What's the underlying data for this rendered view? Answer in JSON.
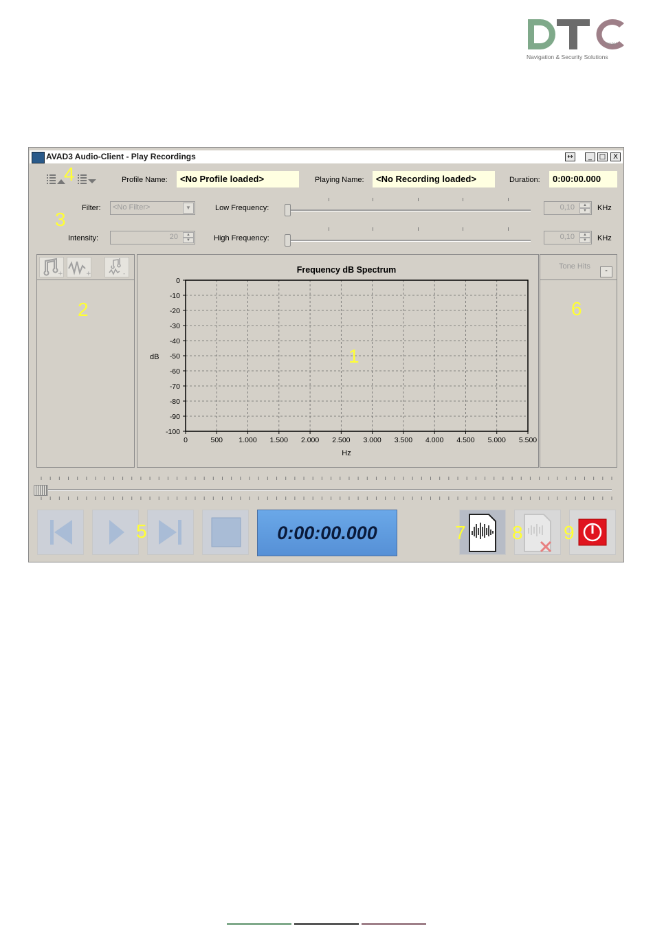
{
  "logo": {
    "text": "DTC",
    "gmbh": "GmbH",
    "tagline": "Navigation & Security Solutions",
    "colors": {
      "green": "#7fa98a",
      "gray": "#6b6b6b",
      "mauve": "#9e7f88"
    }
  },
  "window": {
    "title": "AVAD3 Audio-Client - Play Recordings",
    "buttons": {
      "resize": "↔",
      "minimize": "_",
      "maximize": "□",
      "close": "X"
    }
  },
  "header": {
    "profile_label": "Profile Name:",
    "profile_value": "<No Profile loaded>",
    "playing_label": "Playing Name:",
    "playing_value": "<No Recording loaded>",
    "duration_label": "Duration:",
    "duration_value": "0:00:00.000"
  },
  "filters": {
    "filter_label": "Filter:",
    "filter_value": "<No Filter>",
    "intensity_label": "Intensity:",
    "intensity_value": "20",
    "low_freq_label": "Low Frequency:",
    "low_freq_value": "0,10",
    "high_freq_label": "High Frequency:",
    "high_freq_value": "0,10",
    "unit": "KHz"
  },
  "tone_hits": {
    "label": "Tone Hits",
    "button": "-"
  },
  "transport": {
    "time": "0:00:00.000"
  },
  "annotations": [
    "1",
    "2",
    "3",
    "4",
    "5",
    "6",
    "7",
    "8",
    "9"
  ],
  "chart_data": {
    "type": "line",
    "title": "Frequency dB Spectrum",
    "xlabel": "Hz",
    "ylabel": "dB",
    "x_ticks": [
      "0",
      "500",
      "1.000",
      "1.500",
      "2.000",
      "2.500",
      "3.000",
      "3.500",
      "4.000",
      "4.500",
      "5.000",
      "5.500"
    ],
    "y_ticks": [
      "0",
      "-10",
      "-20",
      "-30",
      "-40",
      "-50",
      "-60",
      "-70",
      "-80",
      "-90",
      "-100"
    ],
    "xlim": [
      0,
      5500
    ],
    "ylim": [
      -100,
      0
    ],
    "grid": true,
    "series": []
  }
}
